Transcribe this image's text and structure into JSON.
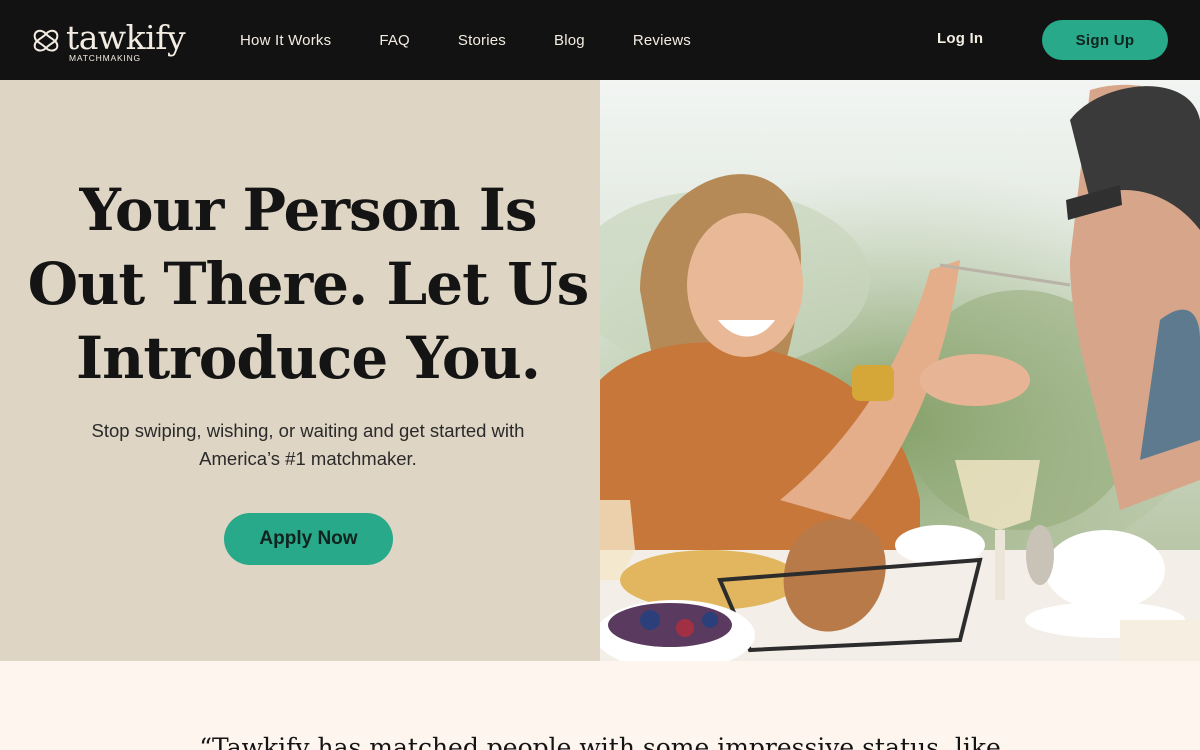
{
  "brand": {
    "name": "tawkify",
    "subtitle": "MATCHMAKING"
  },
  "nav": {
    "links": [
      "How It Works",
      "FAQ",
      "Stories",
      "Blog",
      "Reviews"
    ],
    "login": "Log In",
    "signup": "Sign Up"
  },
  "hero": {
    "title_lines": [
      "Your Person Is",
      "Out There. Let Us",
      "Introduce You."
    ],
    "subtitle_lines": [
      "Stop swiping, wishing, or waiting and get started with",
      "America’s #1 matchmaker."
    ],
    "cta": "Apply Now"
  },
  "quote": {
    "text": "“Tawkify has matched people with some impressive status, like"
  },
  "colors": {
    "nav_bg": "#121212",
    "accent": "#27a98a",
    "hero_bg": "#ded5c4",
    "page_bg": "#fdf5ee"
  }
}
